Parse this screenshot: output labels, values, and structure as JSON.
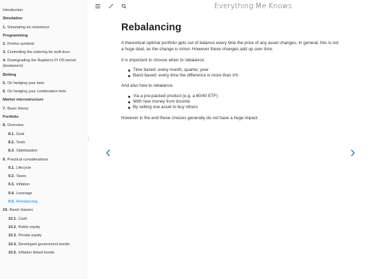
{
  "sidebar": {
    "items": [
      {
        "kind": "item",
        "num": "",
        "label": "Introduction"
      },
      {
        "kind": "part",
        "num": "",
        "label": "Simulation"
      },
      {
        "kind": "item",
        "num": "1.",
        "label": "Simulating air resistance"
      },
      {
        "kind": "part",
        "num": "",
        "label": "Programming"
      },
      {
        "kind": "item",
        "num": "2.",
        "label": "Firefox symbols"
      },
      {
        "kind": "item",
        "num": "3.",
        "label": "Controlling the ordering for wofi-drun"
      },
      {
        "kind": "wrap",
        "num": "4.",
        "label": "Downgrading the Rapberry Pi OS kernel (bookworm)"
      },
      {
        "kind": "part",
        "num": "",
        "label": "Betting"
      },
      {
        "kind": "item",
        "num": "5.",
        "label": "On hedging your bets"
      },
      {
        "kind": "item",
        "num": "6.",
        "label": "On hedging your combination bets"
      },
      {
        "kind": "part",
        "num": "",
        "label": "Market microstructure"
      },
      {
        "kind": "item",
        "num": "7.",
        "label": "Basic theory"
      },
      {
        "kind": "part",
        "num": "",
        "label": "Portfolio"
      },
      {
        "kind": "item",
        "num": "8.",
        "label": "Overview"
      },
      {
        "kind": "sub",
        "num": "8.1.",
        "label": "Goal"
      },
      {
        "kind": "sub",
        "num": "8.2.",
        "label": "Tools"
      },
      {
        "kind": "sub",
        "num": "8.3.",
        "label": "Optimization"
      },
      {
        "kind": "item",
        "num": "9.",
        "label": "Practical considerations"
      },
      {
        "kind": "sub",
        "num": "9.1.",
        "label": "Lifecycle"
      },
      {
        "kind": "sub",
        "num": "9.2.",
        "label": "Taxes"
      },
      {
        "kind": "sub",
        "num": "9.3.",
        "label": "Inflation"
      },
      {
        "kind": "sub",
        "num": "9.4.",
        "label": "Leverage"
      },
      {
        "kind": "sub",
        "num": "9.5.",
        "label": "Rebalancing"
      },
      {
        "kind": "item",
        "num": "10.",
        "label": "Asset classes"
      },
      {
        "kind": "sub",
        "num": "10.1.",
        "label": "Cash"
      },
      {
        "kind": "sub",
        "num": "10.2.",
        "label": "Public equity"
      },
      {
        "kind": "sub",
        "num": "10.3.",
        "label": "Private equity"
      },
      {
        "kind": "sub",
        "num": "10.4.",
        "label": "Developed government bonds"
      },
      {
        "kind": "sub",
        "num": "10.5.",
        "label": "Inflation linked bonds"
      }
    ]
  },
  "topbar": {
    "title": "Everything Me Knows",
    "icons": [
      "menu-icon",
      "brush-icon",
      "search-icon"
    ]
  },
  "content": {
    "heading": "Rebalancing",
    "p1": "A theoretical optimal portfolio gets out of balance every time the price of any asset changes. In general, this is not a huge deal, as the change is minor. However these changes add up over time.",
    "p2": "It is important to choose when to rebalance:",
    "list1": [
      "Time based: every month, quarter, year",
      "Band based: every time the difference is more than x%"
    ],
    "p3": "And also how to rebalance:",
    "list2": [
      "Via a pre-packed product (e.g. a 60/40 ETF)",
      "With new money from income",
      "By selling one asset to buy others"
    ],
    "p4": "However in the end these choices generally do not have a huge impact."
  },
  "nav": {
    "prev": "‹",
    "next": "›"
  }
}
